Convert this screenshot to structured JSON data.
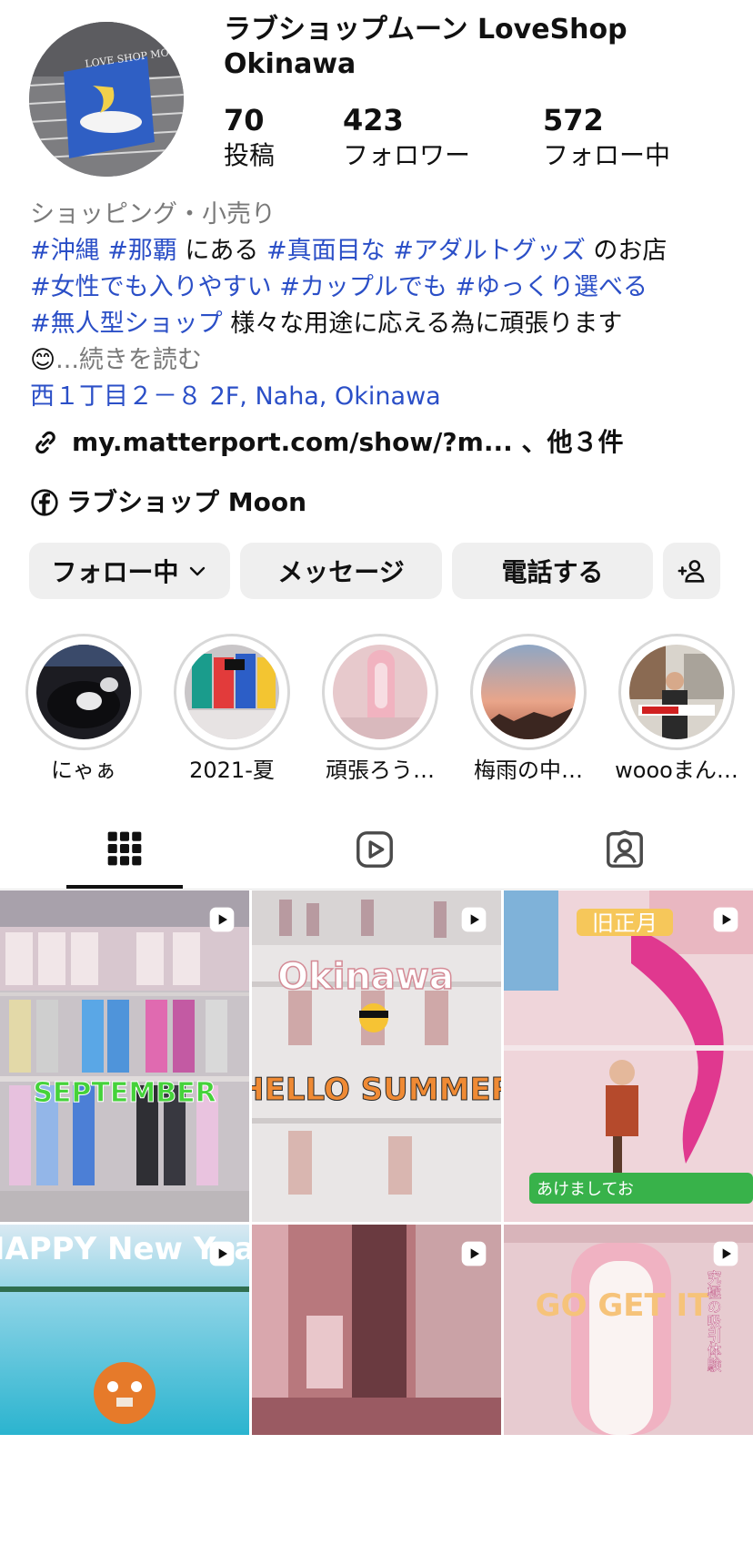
{
  "profile": {
    "name": "ラブショップムーン LoveShop Okinawa",
    "avatar_sign_text": "LOVE SHOP MOON",
    "stats": [
      {
        "count": "70",
        "label": "投稿"
      },
      {
        "count": "423",
        "label": "フォロワー"
      },
      {
        "count": "572",
        "label": "フォロー中"
      }
    ]
  },
  "bio": {
    "category": "ショッピング・小売り",
    "line1_tags_a": "#沖縄 #那覇",
    "line1_text_a": " にある ",
    "line1_tags_b": "#真面目な #アダルトグッズ",
    "line1_text_b": " のお店",
    "line2_tags": "#女性でも入りやすい  #カップルでも #ゆっくり選べる",
    "line3_tags": "#無人型ショップ",
    "line3_text": "  様々な用途に応える為に頑張ります",
    "emoji": "😊",
    "ellipsis": "...",
    "more": "続きを読む",
    "address": "西１丁目２－８ 2F, Naha, Okinawa",
    "link_text": "my.matterport.com/show/?m... 、他３件",
    "facebook_text": "ラブショップ Moon"
  },
  "buttons": {
    "following": "フォロー中",
    "message": "メッセージ",
    "call": "電話する"
  },
  "highlights": [
    {
      "label": "にゃぁ"
    },
    {
      "label": "2021-夏"
    },
    {
      "label": "頑張ろう…"
    },
    {
      "label": "梅雨の中…"
    },
    {
      "label": "woooまん…"
    }
  ],
  "posts": [
    {
      "overlay": "SEPTEMBER"
    },
    {
      "overlay": "Okinawa",
      "overlay2": "HELLO SUMMER"
    },
    {
      "badge": "旧正月",
      "caption": "あけましてお"
    },
    {
      "overlay": "HAPPY New Year"
    },
    {},
    {
      "overlay": "GO GET IT",
      "side_text": "究極の吸引体験"
    }
  ],
  "colors": {
    "link": "#2b4fc7",
    "button_bg": "#efefef",
    "muted": "#7a7a7a"
  },
  "icons": [
    "link-icon",
    "facebook-icon",
    "chevron-down-icon",
    "add-person-icon",
    "grid-icon",
    "reels-icon",
    "tagged-icon",
    "play-icon"
  ]
}
